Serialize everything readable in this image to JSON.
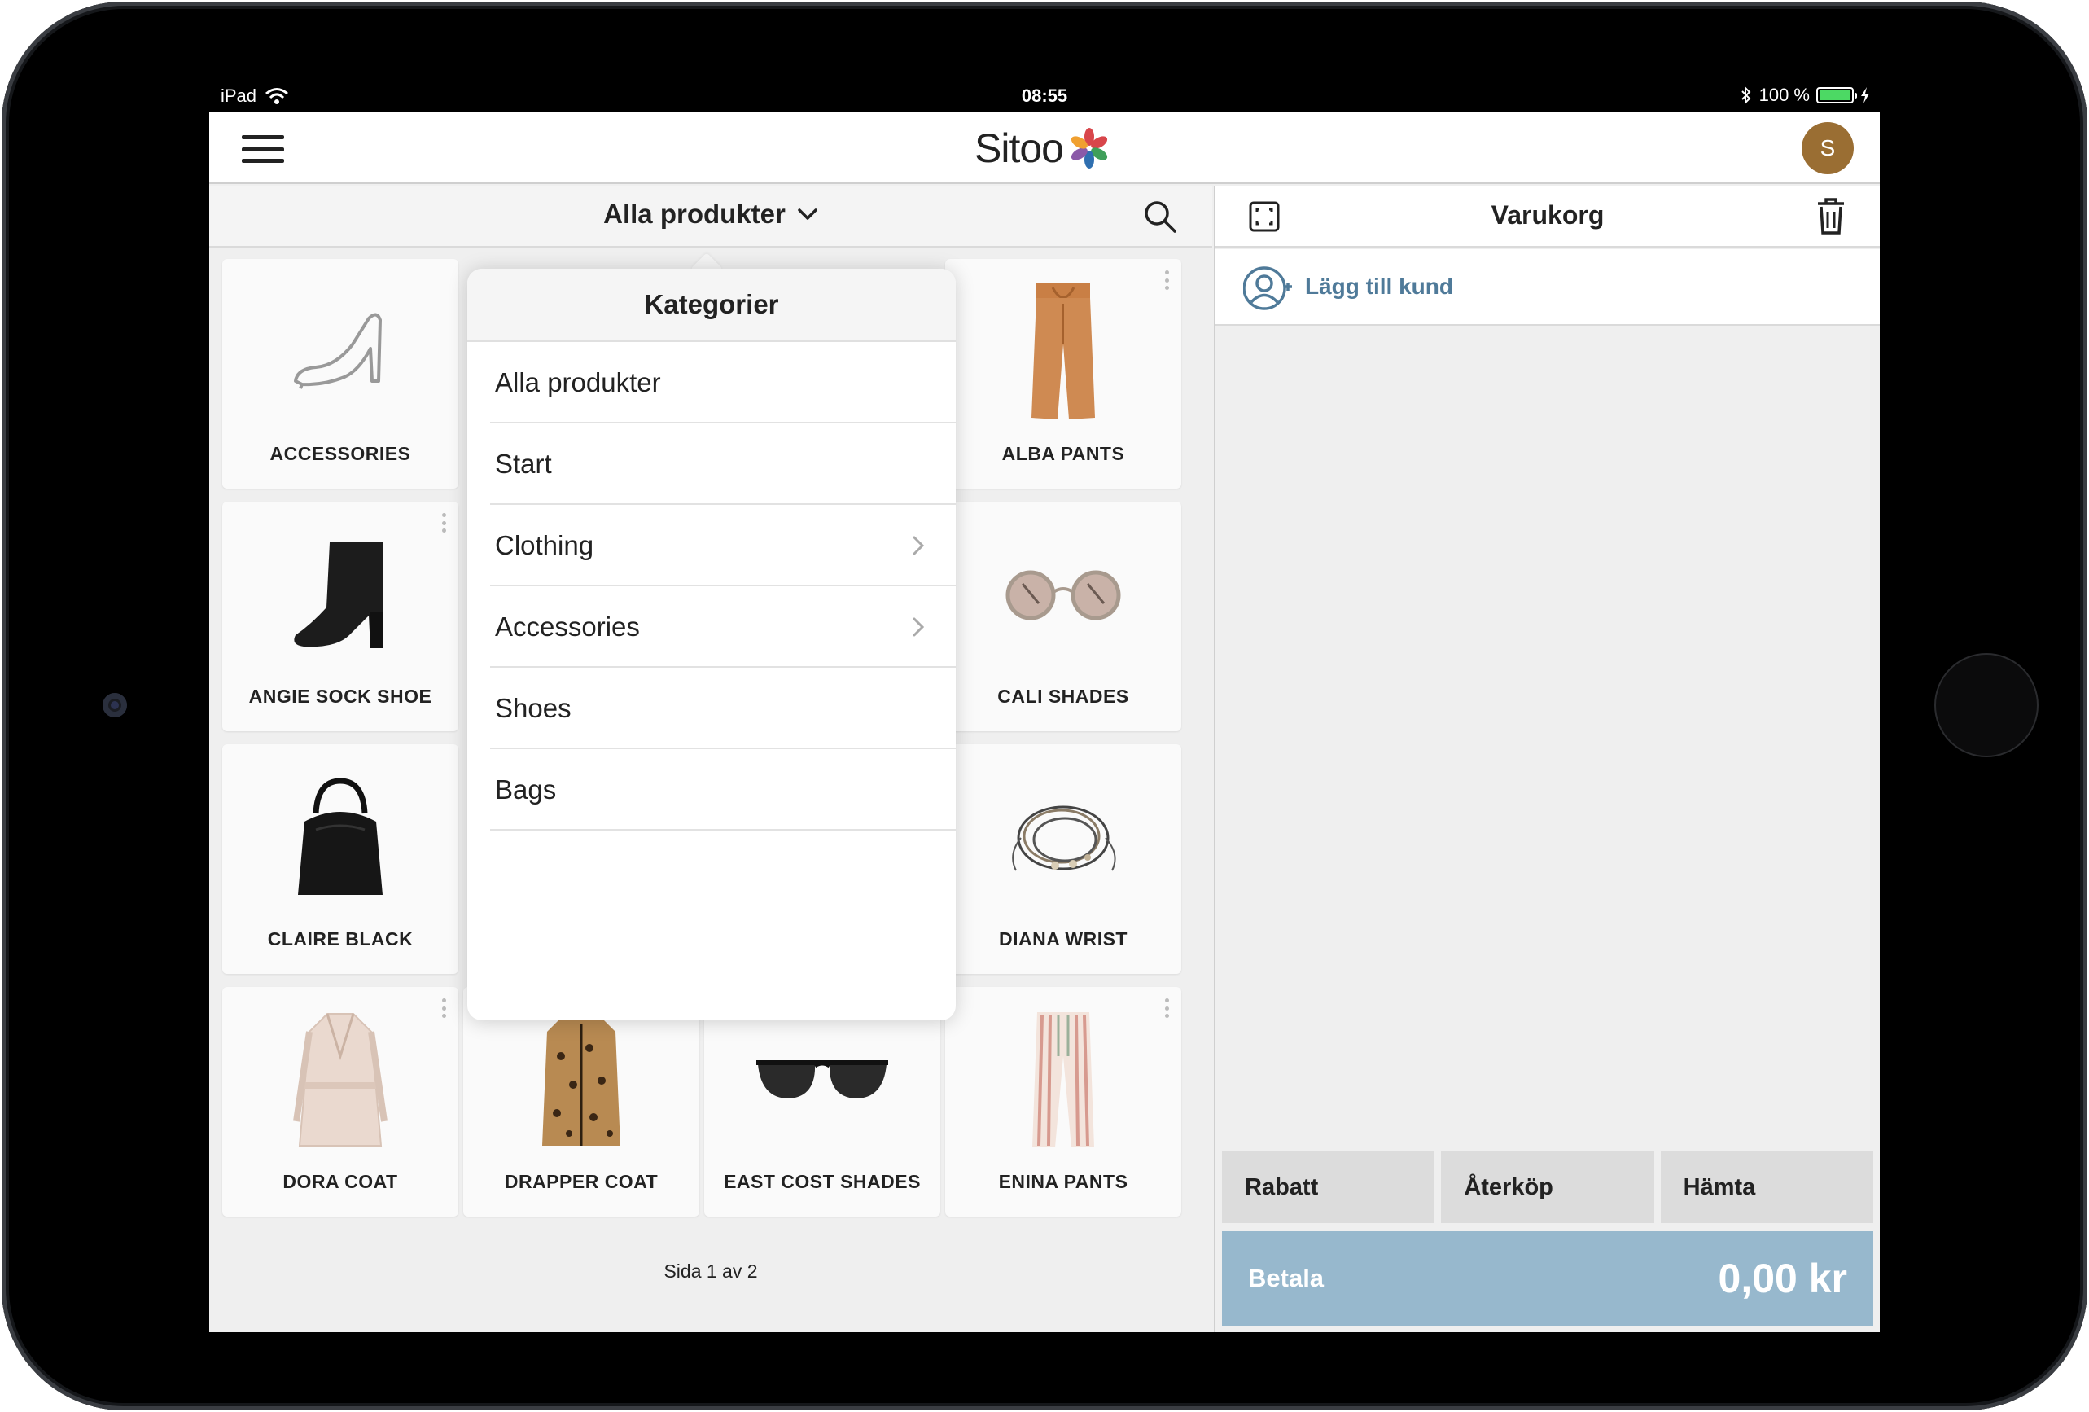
{
  "status_bar": {
    "device": "iPad",
    "time": "08:55",
    "battery": "100 %",
    "battery_level": 1.0
  },
  "header": {
    "brand": "Sitoo",
    "avatar_initial": "S",
    "avatar_color": "#9a6e33"
  },
  "catalog": {
    "category_select": "Alla produkter",
    "pager": "Sida 1 av 2",
    "tiles": [
      {
        "label": "ACCESSORIES",
        "icon": "shoe-outline-icon"
      },
      {
        "label": "ALBA PANTS",
        "icon": "pants-icon"
      },
      {
        "label": "ANGIE SOCK SHOE",
        "icon": "boot-icon"
      },
      {
        "label": "CALI SHADES",
        "icon": "round-sunglasses-icon"
      },
      {
        "label": "CLAIRE BLACK",
        "icon": "handbag-icon"
      },
      {
        "label": "DIANA WRIST",
        "icon": "bracelet-icon"
      },
      {
        "label": "DORA COAT",
        "icon": "coat-icon"
      },
      {
        "label": "DRAPPER COAT",
        "icon": "leopard-coat-icon"
      },
      {
        "label": "EAST COST SHADES",
        "icon": "sunglasses-icon"
      },
      {
        "label": "ENINA PANTS",
        "icon": "striped-pants-icon"
      }
    ]
  },
  "categories_popover": {
    "title": "Kategorier",
    "items": [
      {
        "label": "Alla produkter"
      },
      {
        "label": "Start"
      },
      {
        "label": "Clothing"
      },
      {
        "label": "Accessories"
      },
      {
        "label": "Shoes"
      },
      {
        "label": "Bags"
      }
    ]
  },
  "cart": {
    "title": "Varukorg",
    "add_customer": "Lägg till kund",
    "actions": {
      "discount": "Rabatt",
      "return": "Återköp",
      "fetch": "Hämta"
    },
    "pay_label": "Betala",
    "total": "0,00 kr",
    "pay_color": "#97b8cd",
    "link_color": "#4f7a99"
  }
}
